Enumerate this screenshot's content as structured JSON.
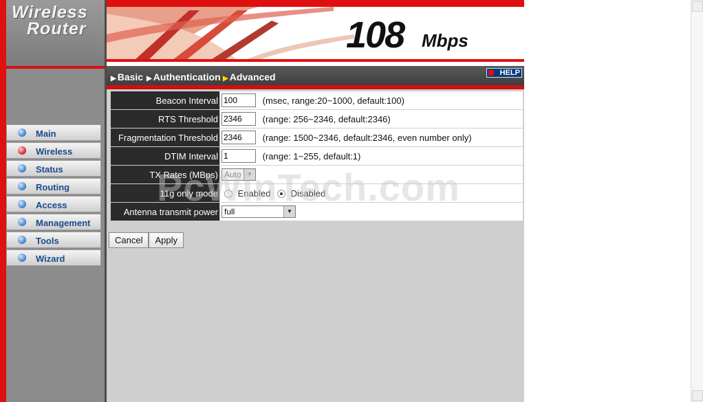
{
  "sidebar": {
    "logo_line1": "Wireless",
    "logo_line2": "Router",
    "items": [
      {
        "label": "Main",
        "active": false
      },
      {
        "label": "Wireless",
        "active": true
      },
      {
        "label": "Status",
        "active": false
      },
      {
        "label": "Routing",
        "active": false
      },
      {
        "label": "Access",
        "active": false
      },
      {
        "label": "Management",
        "active": false
      },
      {
        "label": "Tools",
        "active": false
      },
      {
        "label": "Wizard",
        "active": false
      }
    ]
  },
  "header": {
    "speed": "108",
    "unit": "Mbps",
    "tabs": [
      {
        "label": "Basic",
        "active": false
      },
      {
        "label": "Authentication",
        "active": false
      },
      {
        "label": "Advanced",
        "active": true
      }
    ],
    "help_label": "HELP"
  },
  "settings": {
    "beacon_interval": {
      "label": "Beacon Interval",
      "value": "100",
      "hint": "(msec, range:20~1000, default:100)"
    },
    "rts_threshold": {
      "label": "RTS Threshold",
      "value": "2346",
      "hint": "(range: 256~2346, default:2346)"
    },
    "fragmentation_threshold": {
      "label": "Fragmentation Threshold",
      "value": "2346",
      "hint": "(range: 1500~2346, default:2346, even number only)"
    },
    "dtim_interval": {
      "label": "DTIM Interval",
      "value": "1",
      "hint": "(range: 1~255, default:1)"
    },
    "tx_rates": {
      "label": "TX Rates (MBps)",
      "value": "Auto"
    },
    "g_only_mode": {
      "label": "11g only mode",
      "enabled_label": "Enabled",
      "disabled_label": "Disabled",
      "selected": "Disabled"
    },
    "antenna_power": {
      "label": "Antenna transmit power",
      "value": "full"
    }
  },
  "actions": {
    "cancel_label": "Cancel",
    "apply_label": "Apply"
  },
  "watermark": "PcWinTech.com",
  "colors": {
    "brand_red": "#e01010",
    "label_bg": "#2b2b2b",
    "active_tab_arrow": "#ffd800",
    "nav_text": "#1a4c8a"
  }
}
